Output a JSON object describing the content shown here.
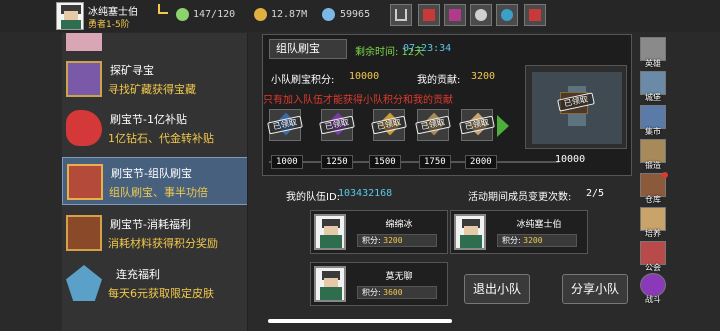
{
  "player": {
    "name": "冰纯塞士伯",
    "rank": "勇者1-5阶"
  },
  "stats": {
    "energy": "147/120",
    "gold": "12.87M",
    "gems": "59965"
  },
  "left_list": [
    {
      "title": "",
      "subtitle": "",
      "partial_text": ""
    },
    {
      "title": "探矿寻宝",
      "subtitle": "寻找矿藏获得宝藏"
    },
    {
      "title": "刷宝节-1亿补贴",
      "subtitle": "1亿钻石、代金转补贴"
    },
    {
      "title": "刷宝节-组队刷宝",
      "subtitle": "组队刷宝、事半功倍"
    },
    {
      "title": "刷宝节-消耗福利",
      "subtitle": "消耗材料获得积分奖励"
    },
    {
      "title": "连充福利",
      "subtitle": "每天6元获取限定皮肤"
    }
  ],
  "panel": {
    "title": "组队刷宝",
    "timer_label": "剩余时间: 12天",
    "timer_value": "07:23:34",
    "team_points_label": "小队刷宝积分:",
    "team_points_value": "10000",
    "my_contrib_label": "我的贡献:",
    "my_contrib_value": "3200",
    "warning": "只有加入队伍才能获得小队积分和我的贡献",
    "claimed_label": "已领取",
    "milestones": [
      "1000",
      "1250",
      "1500",
      "1750",
      "2000"
    ],
    "milestone_end": "10000"
  },
  "team": {
    "id_label": "我的队伍ID:",
    "id_value": "103432168",
    "change_label": "活动期间成员变更次数:",
    "change_value": "2/5",
    "members": [
      {
        "name": "绵绵冰",
        "points_label": "积分:",
        "points": "3200"
      },
      {
        "name": "冰纯塞士伯",
        "points_label": "积分:",
        "points": "3200"
      },
      {
        "name": "莫无聊",
        "points_label": "积分:",
        "points": "3600"
      }
    ],
    "leave_button": "退出小队",
    "share_button": "分享小队"
  },
  "right_nav": [
    "英雄",
    "城堡",
    "集市",
    "锻造",
    "仓库",
    "培养",
    "公会",
    "战斗"
  ],
  "colors": {
    "accent_gold": "#f2c94c",
    "accent_blue": "#58c8e8",
    "warning_red": "#e03a2e",
    "selected": "#46607e"
  }
}
